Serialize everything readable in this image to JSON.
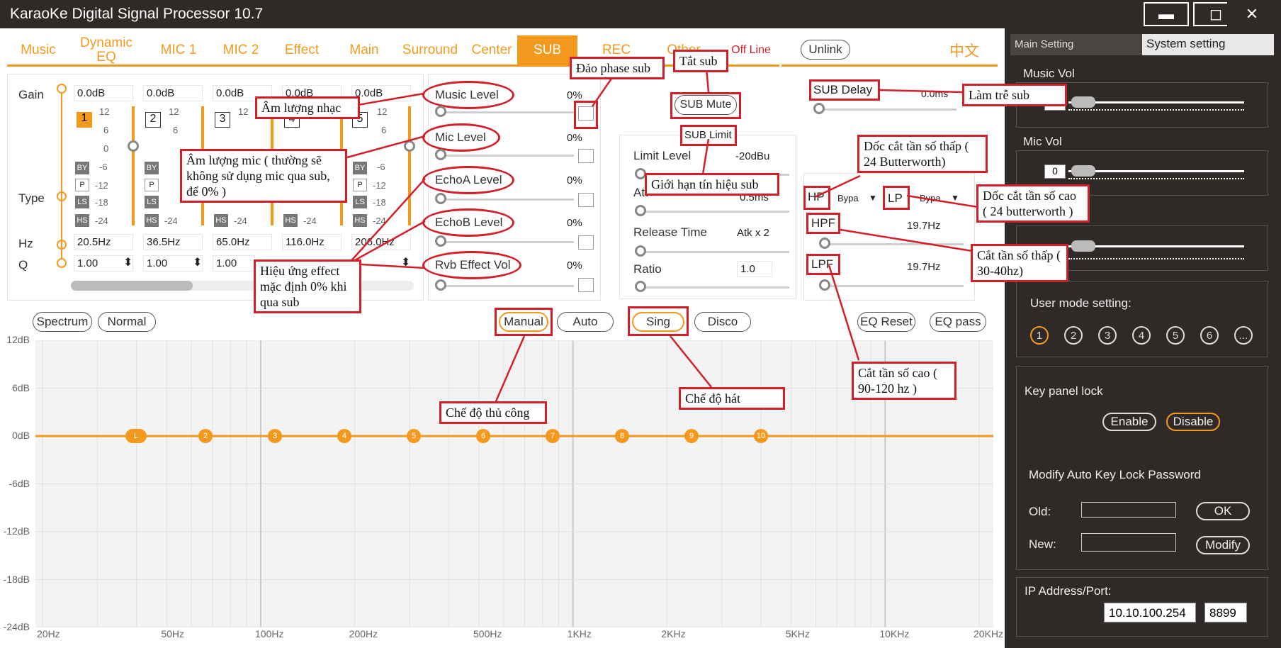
{
  "window": {
    "title": "KaraoKe Digital Signal Processor 10.7",
    "minimize": "▬",
    "maximize": "◻",
    "close": "✕"
  },
  "tabs": [
    "Music",
    "Dynamic EQ",
    "MIC 1",
    "MIC 2",
    "Effect",
    "Main",
    "Surround",
    "Center",
    "SUB",
    "REC",
    "Other",
    "Off Line"
  ],
  "active_tab": "SUB",
  "unlink": "Unlink",
  "lang": "中文",
  "peq": {
    "row_labels": {
      "gain": "Gain",
      "type": "Type",
      "hz": "Hz",
      "q": "Q"
    },
    "bands": [
      {
        "n": "1",
        "gain": "0.0dB",
        "hz": "20.5Hz",
        "q": "1.00"
      },
      {
        "n": "2",
        "gain": "0.0dB",
        "hz": "36.5Hz",
        "q": "1.00"
      },
      {
        "n": "3",
        "gain": "0.0dB",
        "hz": "65.0Hz",
        "q": "1.00"
      },
      {
        "n": "4",
        "gain": "0.0dB",
        "hz": "116.0Hz",
        "q": "1.00"
      },
      {
        "n": "5",
        "gain": "0.0dB",
        "hz": "206.0Hz",
        "q": "1.00"
      }
    ],
    "scale": [
      "12",
      "6",
      "0",
      "-6",
      "-12",
      "-18",
      "-24"
    ],
    "type_buttons": [
      "BY",
      "P",
      "LS",
      "HS"
    ]
  },
  "levels": [
    {
      "label": "Music Level",
      "value": "0%"
    },
    {
      "label": "Mic Level",
      "value": "0%"
    },
    {
      "label": "EchoA Level",
      "value": "0%"
    },
    {
      "label": "EchoB Level",
      "value": "0%"
    },
    {
      "label": "Rvb Effect Vol",
      "value": "0%"
    }
  ],
  "sub_mute": "SUB Mute",
  "limiter": {
    "title": "SUB Limit",
    "limit_level": {
      "label": "Limit Level",
      "value": "-20dBu"
    },
    "attack": {
      "label": "Att",
      "value": "0.5ms"
    },
    "release": {
      "label": "Release Time",
      "value": "Atk x 2"
    },
    "ratio": {
      "label": "Ratio",
      "value": "1.0"
    }
  },
  "delay": {
    "label": "SUB Delay",
    "value": "0.0ms"
  },
  "filters": {
    "hp": "HP",
    "lp": "LP",
    "hp_type": "Bypa",
    "lp_type": "Bypa",
    "hpf": {
      "label": "HPF",
      "value": "19.7Hz"
    },
    "lpf": {
      "label": "LPF",
      "value": "19.7Hz"
    }
  },
  "modes": {
    "spectrum": "Spectrum",
    "normal": "Normal",
    "manual": "Manual",
    "auto": "Auto",
    "sing": "Sing",
    "disco": "Disco",
    "eq_reset": "EQ Reset",
    "eq_pass": "EQ pass"
  },
  "eq_chart": {
    "y_labels": [
      "12dB",
      "6dB",
      "0dB",
      "-6dB",
      "-12dB",
      "-18dB",
      "-24dB"
    ],
    "x_labels": [
      "20Hz",
      "50Hz",
      "100Hz",
      "200Hz",
      "500Hz",
      "1KHz",
      "2KHz",
      "5KHz",
      "10KHz",
      "20KHz"
    ],
    "nodes": [
      "L",
      "2",
      "3",
      "4",
      "5",
      "6",
      "7",
      "8",
      "9",
      "10"
    ]
  },
  "sidebar": {
    "tabs": [
      "Main Setting",
      "System setting"
    ],
    "music_vol": "Music Vol",
    "music_vol_value": "0",
    "mic_vol": "Mic Vol",
    "mic_vol_value": "0",
    "user_mode": "User mode setting:",
    "modes": [
      "1",
      "2",
      "3",
      "4",
      "5",
      "6",
      "..."
    ],
    "key_lock": "Key panel lock",
    "enable": "Enable",
    "disable": "Disable",
    "modify_pw": "Modify Auto Key Lock Password",
    "old": "Old:",
    "new": "New:",
    "ok": "OK",
    "modify": "Modify",
    "ip_label": "IP Address/Port:",
    "ip": "10.10.100.254",
    "port": "8899"
  },
  "annotations": {
    "am_luong_nhac": "Âm lượng nhạc",
    "am_luong_mic": "Âm lượng mic ( thường sẽ không sử dụng mic qua sub, để 0% )",
    "hieu_ung": "Hiệu ứng effect mặc định 0% khi qua sub",
    "dao_phase": "Đảo phase sub",
    "tat_sub": "Tắt sub",
    "gioi_han": "Giới hạn tín hiệu sub",
    "lam_tre": "Làm trễ sub",
    "doc_thap": "Dốc cắt tần số thấp ( 24 Butterworth)",
    "doc_cao": "Dốc cắt tần số cao ( 24 butterworth )",
    "cat_thap": "Cắt tần số thấp ( 30-40hz)",
    "cat_cao": "Cắt tần số cao ( 90-120 hz )",
    "thu_cong": "Chế độ thủ công",
    "hat": "Chế độ hát"
  }
}
